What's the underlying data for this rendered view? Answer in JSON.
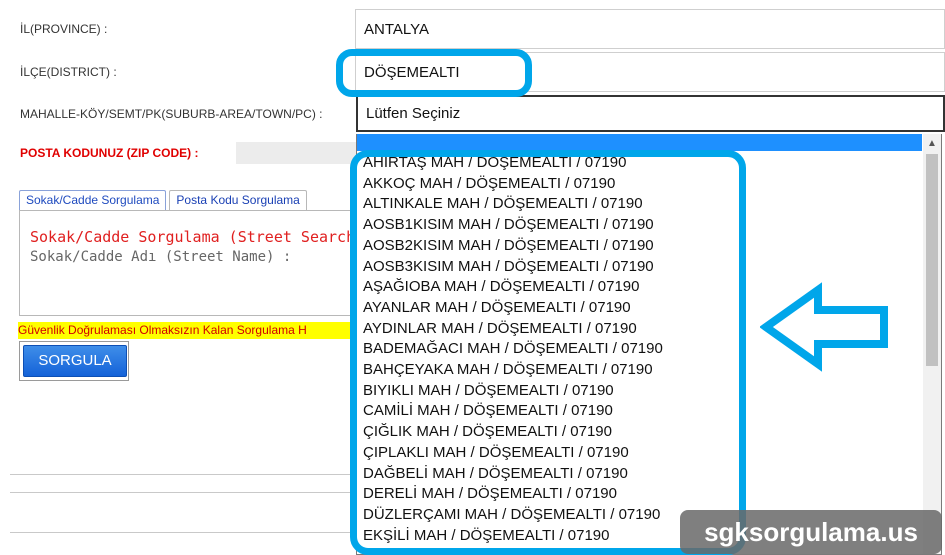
{
  "form": {
    "province_label": "İL(PROVINCE) :",
    "province_value": "ANTALYA",
    "district_label": "İLÇE(DISTRICT) :",
    "district_value": "DÖŞEMEALTI",
    "suburb_label": "MAHALLE-KÖY/SEMT/PK(SUBURB-AREA/TOWN/PC) :",
    "suburb_value": "Lütfen Seçiniz",
    "zip_label": "POSTA KODUNUZ (ZIP CODE) :"
  },
  "tabs": [
    {
      "label": "Sokak/Cadde Sorgulama"
    },
    {
      "label": "Posta Kodu Sorgulama"
    }
  ],
  "panel": {
    "title": "Sokak/Cadde Sorgulama (Street Search",
    "street_name_label": "Sokak/Cadde Adı (Street Name) :"
  },
  "warning_text": "Güvenlik Doğrulaması Olmaksızın Kalan Sorgulama H",
  "sorgula_label": "SORGULA",
  "dropdown": {
    "options": [
      "AHIRTAŞ MAH / DÖŞEMEALTI / 07190",
      "AKKOÇ MAH / DÖŞEMEALTI / 07190",
      "ALTINKALE MAH / DÖŞEMEALTI / 07190",
      "AOSB1KISIM MAH / DÖŞEMEALTI / 07190",
      "AOSB2KISIM MAH / DÖŞEMEALTI / 07190",
      "AOSB3KISIM MAH / DÖŞEMEALTI / 07190",
      "AŞAĞIOBA MAH / DÖŞEMEALTI / 07190",
      "AYANLAR MAH / DÖŞEMEALTI / 07190",
      "AYDINLAR MAH / DÖŞEMEALTI / 07190",
      "BADEMAĞACI MAH / DÖŞEMEALTI / 07190",
      "BAHÇEYAKA MAH / DÖŞEMEALTI / 07190",
      "BIYIKLI MAH / DÖŞEMEALTI / 07190",
      "CAMİLİ MAH / DÖŞEMEALTI / 07190",
      "ÇIĞLIK MAH / DÖŞEMEALTI / 07190",
      "ÇIPLAKLI MAH / DÖŞEMEALTI / 07190",
      "DAĞBELİ MAH / DÖŞEMEALTI / 07190",
      "DERELİ MAH / DÖŞEMEALTI / 07190",
      "DÜZLERÇAMI MAH / DÖŞEMEALTI / 07190",
      "EKŞİLİ MAH / DÖŞEMEALTI / 07190"
    ]
  },
  "watermark": "sgksorgulama.us",
  "colors": {
    "highlight": "#00a6ea",
    "selected_option": "#1e90ff",
    "zip_label": "#e00000",
    "warning_bg": "#ffff00"
  },
  "icons": {
    "arrow": "left-arrow-icon",
    "scroll_up": "scroll-up-icon"
  }
}
